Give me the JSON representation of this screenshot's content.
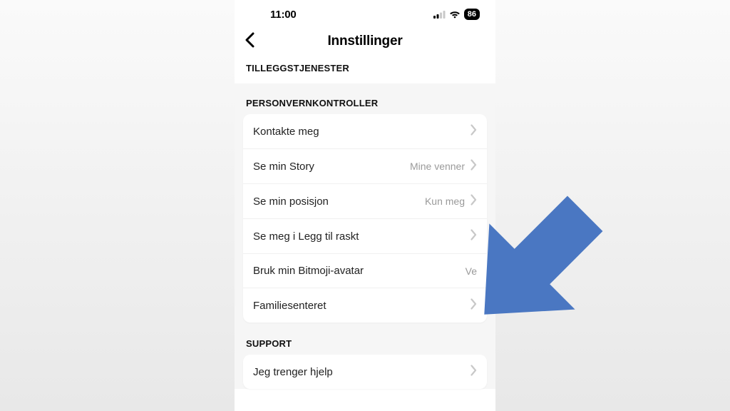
{
  "statusbar": {
    "time": "11:00",
    "battery": "86"
  },
  "navbar": {
    "title": "Innstillinger"
  },
  "sections": {
    "additional": {
      "header": "TILLEGGSTJENESTER"
    },
    "privacy": {
      "header": "PERSONVERNKONTROLLER",
      "rows": {
        "contact": {
          "label": "Kontakte meg",
          "value": ""
        },
        "story": {
          "label": "Se min Story",
          "value": "Mine venner"
        },
        "location": {
          "label": "Se min posisjon",
          "value": "Kun meg"
        },
        "quickadd": {
          "label": "Se meg i Legg til raskt",
          "value": ""
        },
        "bitmoji": {
          "label": "Bruk min Bitmoji-avatar",
          "value": "Ve"
        },
        "family": {
          "label": "Familiesenteret",
          "value": ""
        }
      }
    },
    "support": {
      "header": "SUPPORT",
      "rows": {
        "help": {
          "label": "Jeg trenger hjelp",
          "value": ""
        }
      }
    }
  },
  "annotation": {
    "arrow_color": "#4a77c2"
  }
}
